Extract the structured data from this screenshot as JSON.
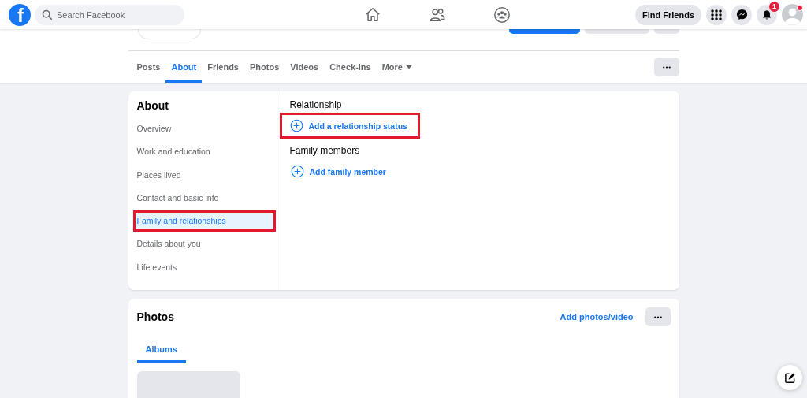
{
  "header": {
    "logo": "f",
    "search": {
      "placeholder": "Search Facebook"
    },
    "find_friends": "Find Friends",
    "notifications_badge": "1"
  },
  "profile_tabs": [
    {
      "label": "Posts",
      "selected": false
    },
    {
      "label": "About",
      "selected": true
    },
    {
      "label": "Friends",
      "selected": false
    },
    {
      "label": "Photos",
      "selected": false
    },
    {
      "label": "Videos",
      "selected": false
    },
    {
      "label": "Check-ins",
      "selected": false
    },
    {
      "label": "More",
      "selected": false,
      "kind": "menu"
    }
  ],
  "about": {
    "title": "About",
    "sidebar": [
      {
        "label": "Overview",
        "selected": false,
        "highlighted": false
      },
      {
        "label": "Work and education",
        "selected": false,
        "highlighted": false
      },
      {
        "label": "Places lived",
        "selected": false,
        "highlighted": false
      },
      {
        "label": "Contact and basic info",
        "selected": false,
        "highlighted": false
      },
      {
        "label": "Family and relationships",
        "selected": true,
        "highlighted": true
      },
      {
        "label": "Details about you",
        "selected": false,
        "highlighted": false
      },
      {
        "label": "Life events",
        "selected": false,
        "highlighted": false
      }
    ],
    "sections": [
      {
        "heading": "Relationship",
        "action": "Add a relationship status",
        "highlighted": true
      },
      {
        "heading": "Family members",
        "action": "Add family member",
        "highlighted": false
      }
    ]
  },
  "photos": {
    "title": "Photos",
    "add_link": "Add photos/video",
    "tabs": [
      {
        "label": "Albums",
        "selected": true
      }
    ]
  }
}
